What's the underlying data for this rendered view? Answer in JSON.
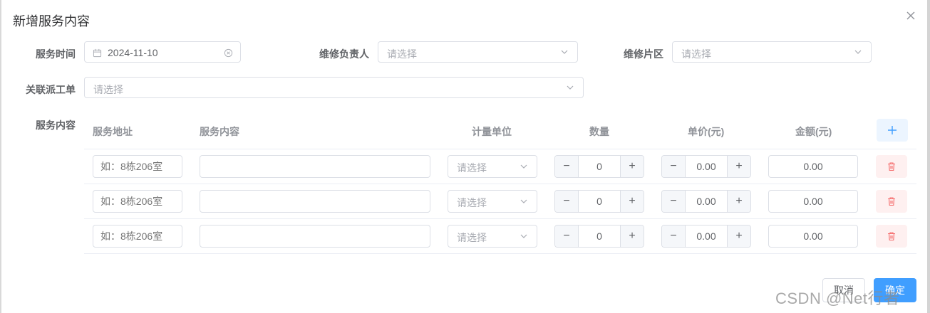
{
  "dialog": {
    "title": "新增服务内容"
  },
  "form": {
    "service_time": {
      "label": "服务时间",
      "value": "2024-11-10"
    },
    "repair_manager": {
      "label": "维修负责人",
      "placeholder": "请选择"
    },
    "repair_area": {
      "label": "维修片区",
      "placeholder": "请选择"
    },
    "work_order": {
      "label": "关联派工单",
      "placeholder": "请选择"
    },
    "service_content_label": "服务内容"
  },
  "table": {
    "headers": [
      "服务地址",
      "服务内容",
      "计量单位",
      "数量",
      "单价(元)",
      "金额(元)"
    ],
    "rows": [
      {
        "address_placeholder": "如：8栋206室",
        "content": "",
        "unit_placeholder": "请选择",
        "quantity": "0",
        "price": "0.00",
        "amount": "0.00"
      },
      {
        "address_placeholder": "如：8栋206室",
        "content": "",
        "unit_placeholder": "请选择",
        "quantity": "0",
        "price": "0.00",
        "amount": "0.00"
      },
      {
        "address_placeholder": "如：8栋206室",
        "content": "",
        "unit_placeholder": "请选择",
        "quantity": "0",
        "price": "0.00",
        "amount": "0.00"
      }
    ]
  },
  "footer": {
    "cancel_label": "取消",
    "confirm_label": "确定"
  },
  "watermark": "CSDN @Net行者",
  "colors": {
    "primary": "#409eff",
    "danger": "#f56c6c",
    "border": "#dcdfe6",
    "placeholder": "#a8abb2"
  }
}
